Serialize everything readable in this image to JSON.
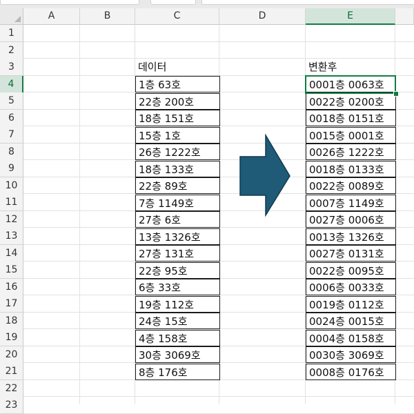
{
  "columns": [
    "A",
    "B",
    "C",
    "D",
    "E"
  ],
  "selected_column": "E",
  "rows": [
    "1",
    "2",
    "3",
    "4",
    "5",
    "6",
    "7",
    "8",
    "9",
    "10",
    "11",
    "12",
    "13",
    "14",
    "15",
    "16",
    "17",
    "18",
    "19",
    "20",
    "21",
    "22",
    "23"
  ],
  "selected_row": "4",
  "headers": {
    "source": "데이터",
    "result": "변환후"
  },
  "source_values": [
    "1층 63호",
    "22층 200호",
    "18층 151호",
    "15층 1호",
    "26층 1222호",
    "18층 133호",
    "22층 89호",
    "7층 1149호",
    "27층 6호",
    "13층 1326호",
    "27층 131호",
    "22층 95호",
    "6층 33호",
    "19층 112호",
    "24층 15호",
    "4층 158호",
    "30층 3069호",
    "8층 176호"
  ],
  "converted_values": [
    "0001층 0063호",
    "0022층 0200호",
    "0018층 0151호",
    "0015층 0001호",
    "0026층 1222호",
    "0018층 0133호",
    "0022층 0089호",
    "0007층 1149호",
    "0027층 0006호",
    "0013층 1326호",
    "0027층 0131호",
    "0022층 0095호",
    "0006층 0033호",
    "0019층 0112호",
    "0024층 0015호",
    "0004층 0158호",
    "0030층 3069호",
    "0008층 0176호"
  ],
  "arrow_icon": "right-arrow-icon",
  "colors": {
    "accent": "#107c41",
    "arrow_fill": "#1f5a77",
    "header_bg": "#f3f3f3"
  }
}
